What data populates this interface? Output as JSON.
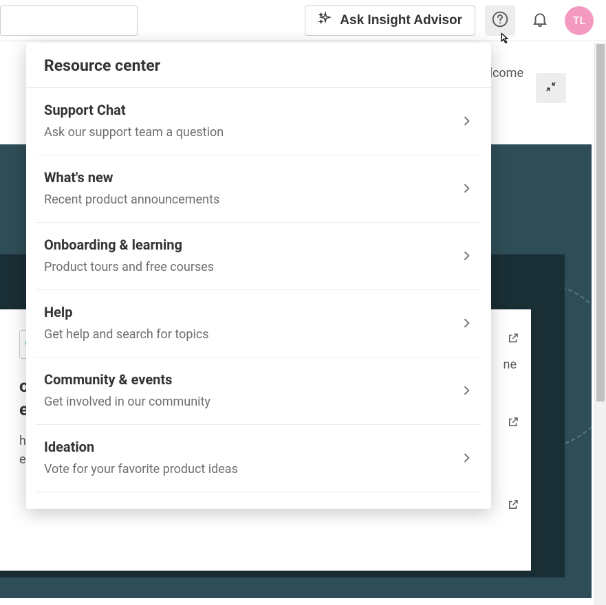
{
  "topbar": {
    "search_placeholder": "",
    "ask_label": "Ask Insight Advisor",
    "avatar_initials": "TL"
  },
  "welcome_text": "lcome",
  "card": {
    "title_line1": "ore t",
    "title_line2": "emo",
    "body_line1": "hat C",
    "body_line2": "e can"
  },
  "side_text_fragment": "ne",
  "popover": {
    "title": "Resource center",
    "items": [
      {
        "title": "Support Chat",
        "desc": "Ask our support team a question"
      },
      {
        "title": "What's new",
        "desc": "Recent product announcements"
      },
      {
        "title": "Onboarding & learning",
        "desc": "Product tours and free courses"
      },
      {
        "title": "Help",
        "desc": "Get help and search for topics"
      },
      {
        "title": "Community & events",
        "desc": "Get involved in our community"
      },
      {
        "title": "Ideation",
        "desc": "Vote for your favorite product ideas"
      }
    ]
  }
}
